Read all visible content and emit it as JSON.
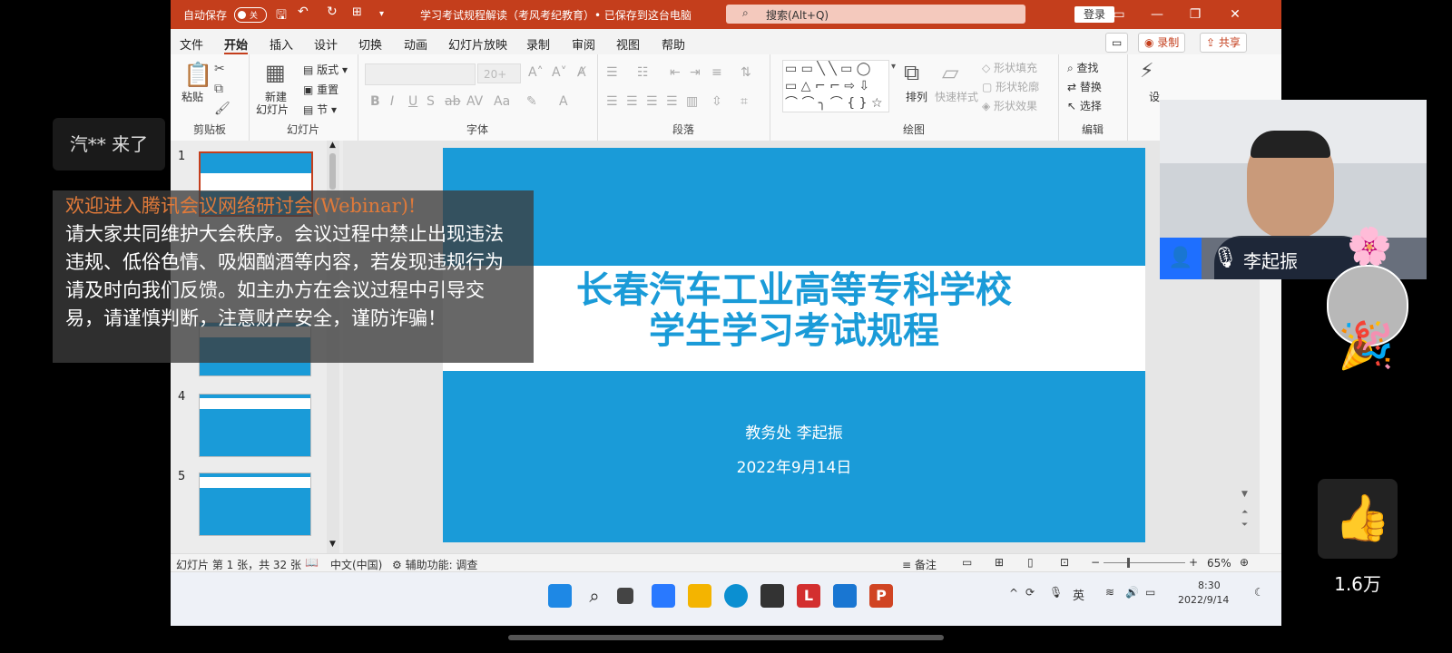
{
  "window": {
    "autosave_label": "自动保存",
    "autosave_state": "关",
    "doc_title": "学习考试规程解读（考风考纪教育）• 已保存到这台电脑",
    "search_placeholder": "搜索(Alt+Q)",
    "login_label": "登录"
  },
  "menu": {
    "items": [
      "文件",
      "开始",
      "插入",
      "设计",
      "切换",
      "动画",
      "幻灯片放映",
      "录制",
      "审阅",
      "视图",
      "帮助"
    ],
    "record_label": "录制",
    "share_label": "共享"
  },
  "ribbon": {
    "clipboard": {
      "paste": "粘贴",
      "group": "剪贴板"
    },
    "slides": {
      "new_slide": "新建",
      "new_slide2": "幻灯片",
      "layout": "版式",
      "reset": "重置",
      "section": "节",
      "group": "幻灯片"
    },
    "font": {
      "size": "20+",
      "group": "字体"
    },
    "paragraph": {
      "group": "段落"
    },
    "drawing": {
      "arrange": "排列",
      "quick_styles": "快速样式",
      "fill": "形状填充",
      "outline": "形状轮廓",
      "effects": "形状效果",
      "group": "绘图"
    },
    "editing": {
      "find": "查找",
      "replace": "替换",
      "select": "选择",
      "group": "编辑"
    },
    "design": "设"
  },
  "thumbnails": {
    "numbers": [
      "1",
      "4",
      "5"
    ]
  },
  "slide": {
    "title_line1": "长春汽车工业高等专科学校",
    "title_line2": "学生学习考试规程",
    "subtitle": "教务处    李起振",
    "date": "2022年9月14日"
  },
  "statusbar": {
    "slide_info": "幻灯片 第 1 张，共 32 张",
    "language": "中文(中国)",
    "accessibility": "辅助功能: 调查",
    "notes": "备注",
    "zoom": "65%"
  },
  "taskbar": {
    "time": "8:30",
    "date": "2022/9/14",
    "ime": "英"
  },
  "overlay": {
    "chat_message": "汽** 来了",
    "notice_title": "欢迎进入腾讯会议网络研讨会(Webinar)!",
    "notice_body": "请大家共同维护大会秩序。会议过程中禁止出现违法违规、低俗色情、吸烟酗酒等内容，若发现违规行为请及时向我们反馈。如主办方在会议过程中引导交易，请谨慎判断，注意财产安全，谨防诈骗！",
    "speaker_name": "李起振",
    "like_count": "1.6万"
  },
  "colors": {
    "accent": "#c43e1c",
    "slide_blue": "#1a9bd8"
  }
}
